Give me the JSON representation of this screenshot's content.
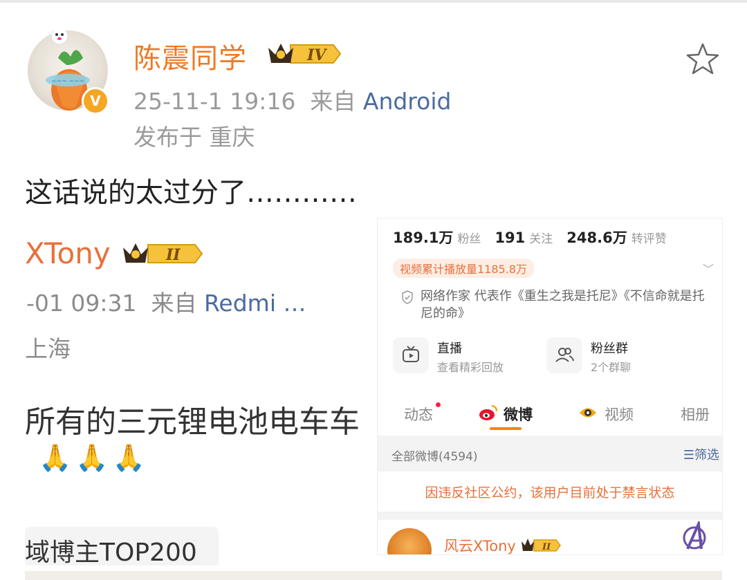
{
  "post": {
    "username": "陈震同学",
    "level_badge": "IV",
    "verified_badge": "V",
    "time": "25-11-1 19:16",
    "from_label": "来自",
    "source": "Android",
    "location": "发布于 重庆",
    "text": "这话说的太过分了…………"
  },
  "left_screenshot": {
    "name": "XTony",
    "level_badge": "II",
    "time": "-01 09:31",
    "from_label": "来自",
    "source": "Redmi …",
    "location": "上海",
    "text": "所有的三元锂电池电车车",
    "emoji": "🙏🙏🙏",
    "tag": "域博主TOP200"
  },
  "right_screenshot": {
    "followers_value": "189.1万",
    "followers_label": "粉丝",
    "following_value": "191",
    "following_label": "关注",
    "likes_value": "248.6万",
    "likes_label": "转评赞",
    "play_count": "视频累计播放量1185.8万",
    "writer_desc": "网络作家 代表作《重生之我是托尼》《不信命就是托尼的命》",
    "live_title": "直播",
    "live_sub": "查看精彩回放",
    "fans_group_title": "粉丝群",
    "fans_group_sub": "2个群聊",
    "tabs": [
      "动态",
      "微博",
      "视频",
      "相册"
    ],
    "all_weibo": "全部微博(4594)",
    "filter": "筛选",
    "banned_notice": "因违反社区公约，该用户目前处于禁言状态",
    "footer_name": "风云XTony",
    "footer_level": "II"
  },
  "colors": {
    "brand_orange": "#ef7a24",
    "link_blue": "#4a6b9f",
    "meta_gray": "#9a9a9a"
  },
  "icons": [
    "star-icon",
    "crown-badge-icon",
    "verified-icon",
    "shield-check-icon",
    "tv-icon",
    "people-icon",
    "weibo-logo-icon",
    "eye-icon",
    "filter-icon",
    "avengers-logo-icon"
  ]
}
